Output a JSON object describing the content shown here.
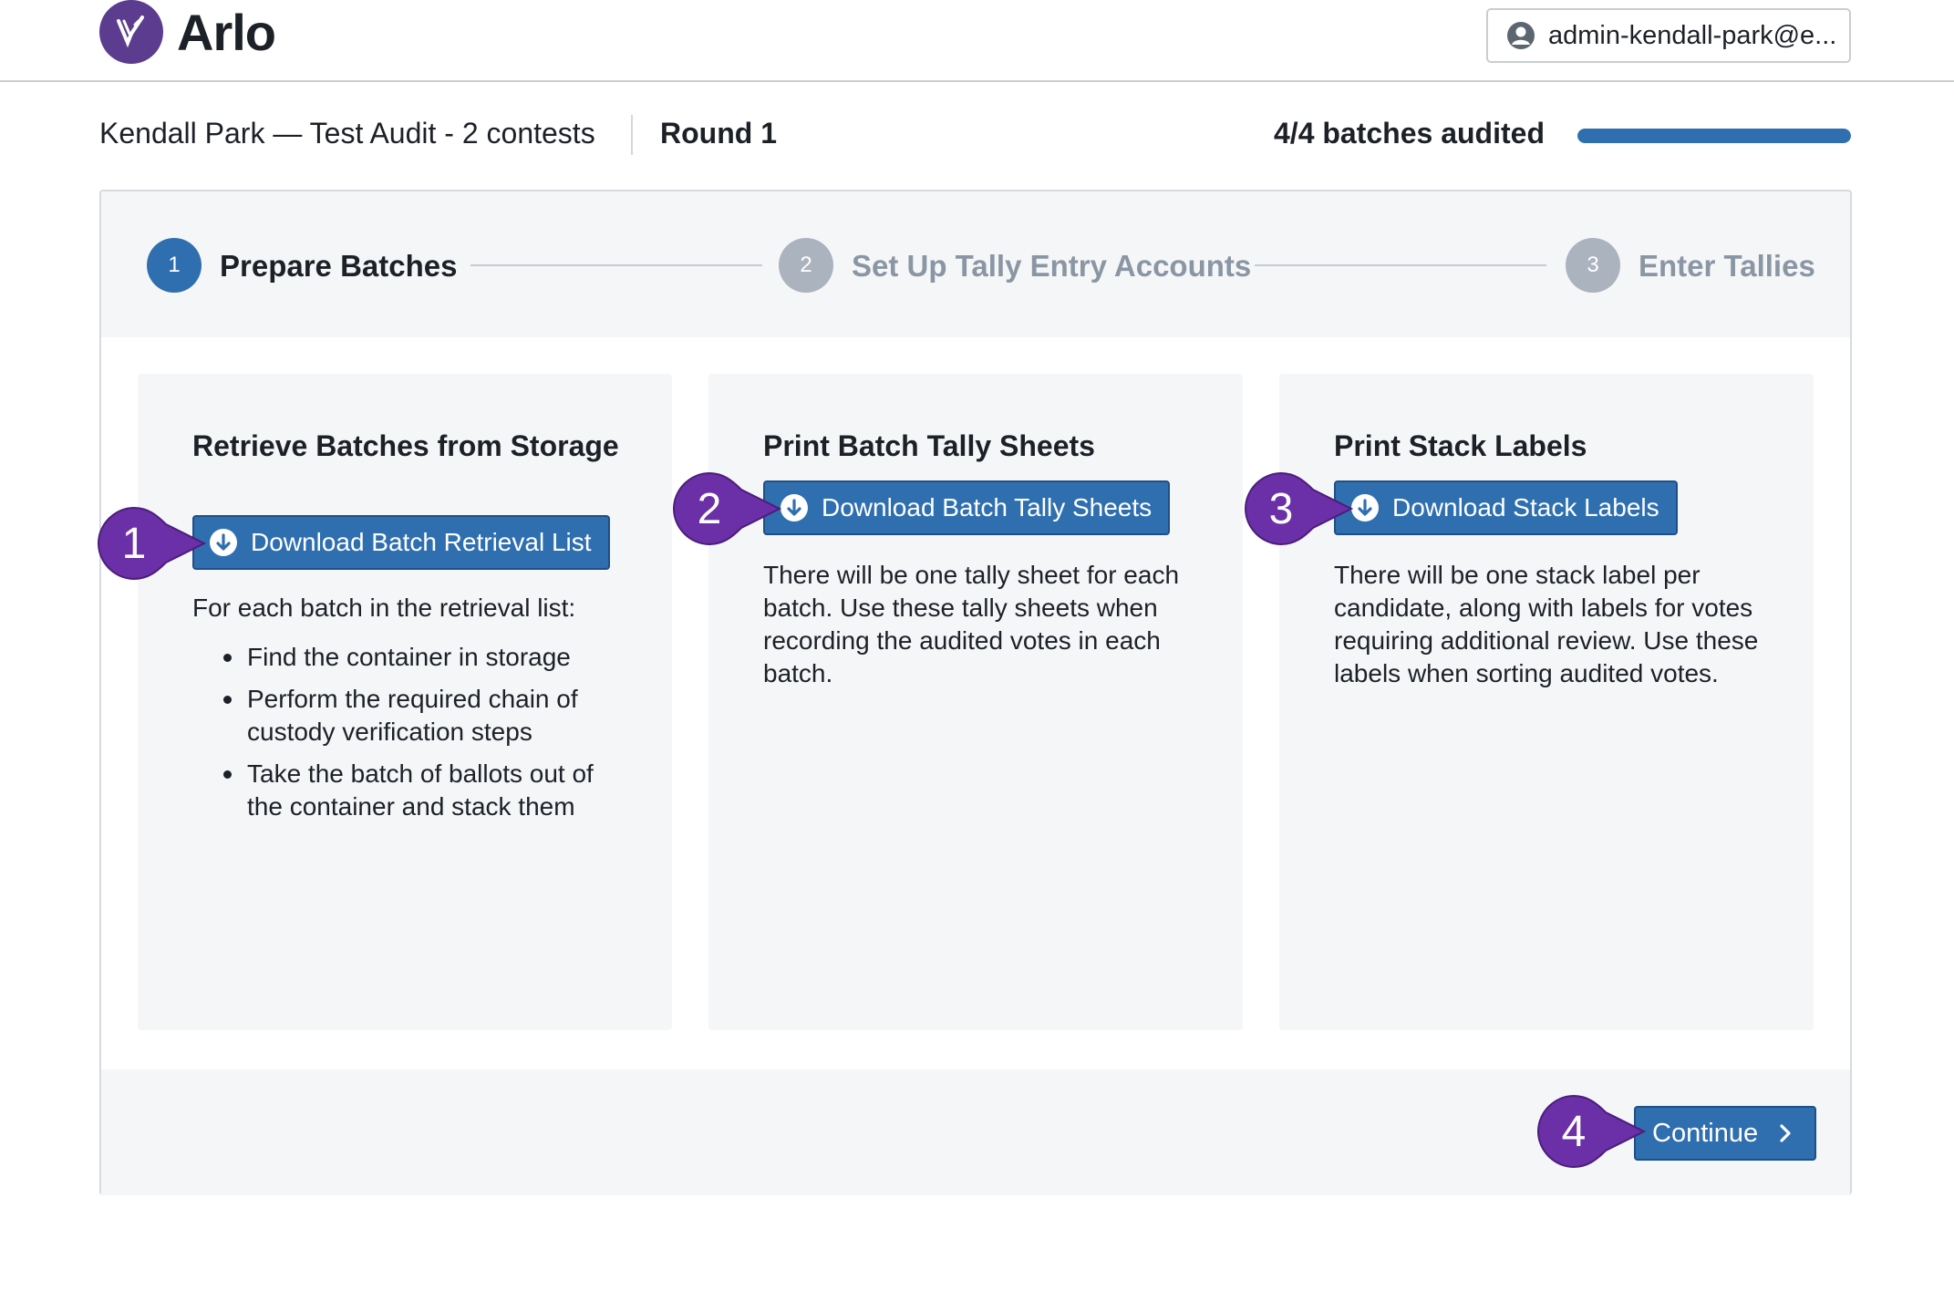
{
  "app": {
    "name": "Arlo"
  },
  "user": {
    "label": "admin-kendall-park@e..."
  },
  "audit": {
    "name": "Kendall Park — Test Audit - 2 contests",
    "round": "Round 1",
    "progress_text": "4/4 batches audited",
    "progress_fraction": 1.0
  },
  "steps": [
    {
      "number": "1",
      "label": "Prepare Batches",
      "state": "active"
    },
    {
      "number": "2",
      "label": "Set Up Tally Entry Accounts",
      "state": "inactive"
    },
    {
      "number": "3",
      "label": "Enter Tallies",
      "state": "inactive"
    }
  ],
  "panels": [
    {
      "title": "Retrieve Batches from Storage",
      "button": "Download Batch Retrieval List",
      "text": "For each batch in the retrieval list:",
      "list": [
        "Find the container in storage",
        "Perform the required chain of custody verification steps",
        "Take the batch of ballots out of the container and stack them"
      ]
    },
    {
      "title": "Print Batch Tally Sheets",
      "button": "Download Batch Tally Sheets",
      "text": "There will be one tally sheet for each batch. Use these tally sheets when recording the audited votes in each batch."
    },
    {
      "title": "Print Stack Labels",
      "button": "Download Stack Labels",
      "text": "There will be one stack label per candidate, along with labels for votes requiring additional review. Use these labels when sorting audited votes."
    }
  ],
  "footer": {
    "continue_label": "Continue"
  },
  "callouts": [
    "1",
    "2",
    "3",
    "4"
  ],
  "colors": {
    "primary": "#2f6fb0",
    "brand": "#5b3c8f",
    "callout": "#6b2fa8"
  }
}
